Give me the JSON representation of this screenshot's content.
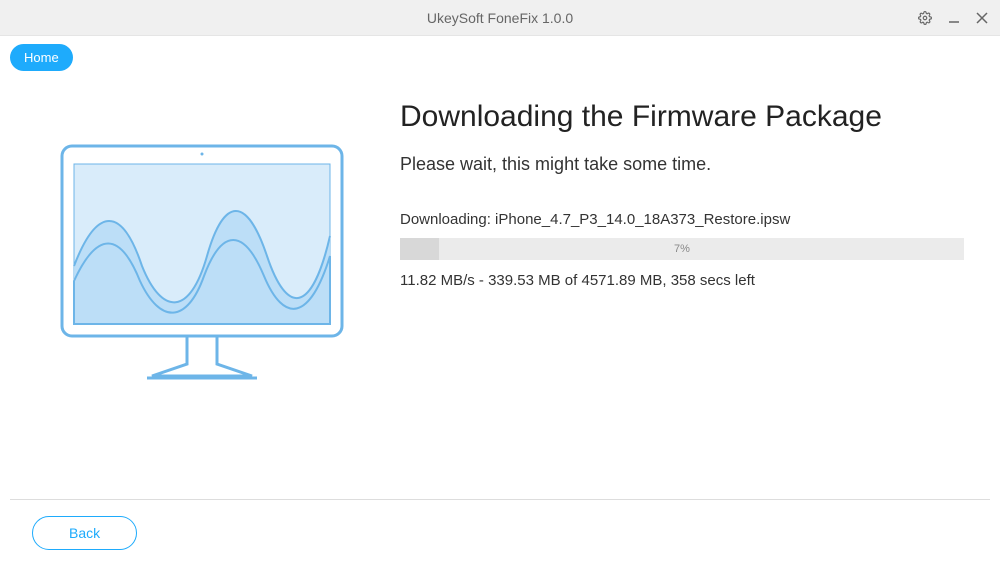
{
  "titlebar": {
    "title": "UkeySoft FoneFix 1.0.0"
  },
  "nav": {
    "home_label": "Home"
  },
  "main": {
    "heading": "Downloading the Firmware Package",
    "subheading": "Please wait, this might take some time.",
    "downloading_prefix": "Downloading: iPhone_4.7_P3_14.0_18A373_Restore.ipsw",
    "progress_percent": "7%",
    "progress_value": 7,
    "status_text": "11.82 MB/s - 339.53 MB of 4571.89 MB, 358 secs left"
  },
  "footer": {
    "back_label": "Back"
  },
  "colors": {
    "accent": "#1eabfc"
  }
}
